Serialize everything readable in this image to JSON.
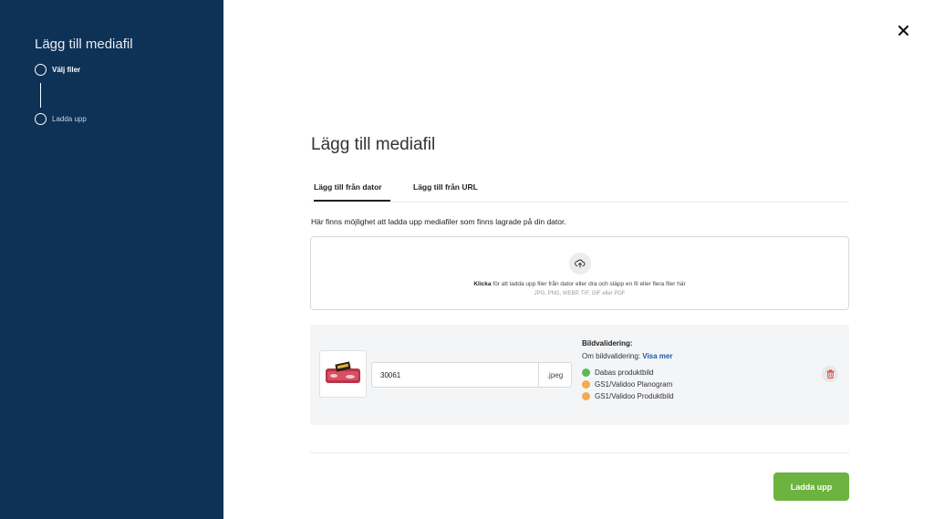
{
  "sidebar": {
    "title": "Lägg till mediafil",
    "steps": [
      {
        "label": "Välj filer",
        "active": true
      },
      {
        "label": "Ladda upp",
        "active": false
      }
    ]
  },
  "main": {
    "title": "Lägg till mediafil",
    "tabs": [
      {
        "label": "Lägg till från dator",
        "active": true
      },
      {
        "label": "Lägg till från URL",
        "active": false
      }
    ],
    "description": "Här finns möjlighet att ladda upp mediafiler som finns lagrade på din dator.",
    "dropzone": {
      "click_word": "Klicka",
      "text": " för att ladda upp filer från dator eller dra och släpp en fil eller flera filer här",
      "formats": "JPG, PNG, WEBP, TIF, GIF eller PDF"
    },
    "file": {
      "name_value": "30061",
      "extension": ".jpeg",
      "validation_title": "Bildvalidering:",
      "validation_about": "Om bildvalidering:",
      "validation_link": "Visa mer",
      "validations": [
        {
          "label": "Dabas produktbild",
          "status": "green"
        },
        {
          "label": "GS1/Validoo Planogram",
          "status": "yellow"
        },
        {
          "label": "GS1/Validoo Produktbild",
          "status": "yellow"
        }
      ]
    },
    "upload_button": "Ladda upp"
  },
  "colors": {
    "sidebar_bg": "#0e3156",
    "accent_green": "#6cb33f",
    "link_blue": "#1a5aa8",
    "status_green": "#5cb85c",
    "status_yellow": "#f0ad4e"
  },
  "icons": {
    "close": "close-icon",
    "upload": "cloud-upload-icon",
    "delete": "trash-icon"
  }
}
